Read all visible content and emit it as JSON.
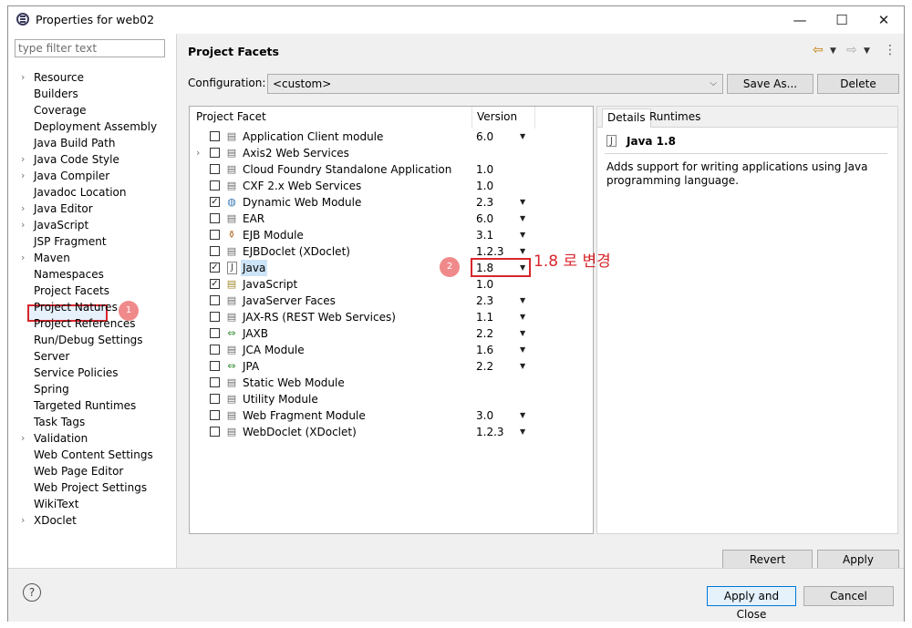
{
  "window": {
    "title": "Properties for web02",
    "minimize": "—",
    "maximize": "☐",
    "close": "✕"
  },
  "filter": {
    "placeholder": "type filter text"
  },
  "tree": {
    "items": [
      {
        "label": "Resource",
        "expandable": true
      },
      {
        "label": "Builders",
        "expandable": false
      },
      {
        "label": "Coverage",
        "expandable": false
      },
      {
        "label": "Deployment Assembly",
        "expandable": false
      },
      {
        "label": "Java Build Path",
        "expandable": false
      },
      {
        "label": "Java Code Style",
        "expandable": true
      },
      {
        "label": "Java Compiler",
        "expandable": true
      },
      {
        "label": "Javadoc Location",
        "expandable": false
      },
      {
        "label": "Java Editor",
        "expandable": true
      },
      {
        "label": "JavaScript",
        "expandable": true
      },
      {
        "label": "JSP Fragment",
        "expandable": false
      },
      {
        "label": "Maven",
        "expandable": true
      },
      {
        "label": "Namespaces",
        "expandable": false
      },
      {
        "label": "Project Facets",
        "expandable": false,
        "selected": true
      },
      {
        "label": "Project Natures",
        "expandable": false
      },
      {
        "label": "Project References",
        "expandable": false
      },
      {
        "label": "Run/Debug Settings",
        "expandable": false
      },
      {
        "label": "Server",
        "expandable": false
      },
      {
        "label": "Service Policies",
        "expandable": false
      },
      {
        "label": "Spring",
        "expandable": false
      },
      {
        "label": "Targeted Runtimes",
        "expandable": false
      },
      {
        "label": "Task Tags",
        "expandable": false
      },
      {
        "label": "Validation",
        "expandable": true
      },
      {
        "label": "Web Content Settings",
        "expandable": false
      },
      {
        "label": "Web Page Editor",
        "expandable": false
      },
      {
        "label": "Web Project Settings",
        "expandable": false
      },
      {
        "label": "WikiText",
        "expandable": false
      },
      {
        "label": "XDoclet",
        "expandable": true
      }
    ]
  },
  "annotations": {
    "badge1": "1",
    "badge2": "2",
    "note": "1.8 로 변경",
    "color": "#d8262c"
  },
  "page": {
    "title": "Project Facets"
  },
  "config": {
    "label": "Configuration:",
    "value": "<custom>",
    "save_as": "Save As...",
    "delete": "Delete"
  },
  "facets": {
    "header_facet": "Project Facet",
    "header_version": "Version",
    "rows": [
      {
        "name": "Application Client module",
        "version": "6.0",
        "checked": false,
        "dropdown": true,
        "icon": "page-icon"
      },
      {
        "name": "Axis2 Web Services",
        "version": "",
        "checked": false,
        "dropdown": false,
        "icon": "page-icon",
        "expandable": true
      },
      {
        "name": "Cloud Foundry Standalone Application",
        "version": "1.0",
        "checked": false,
        "dropdown": false,
        "icon": "page-icon"
      },
      {
        "name": "CXF 2.x Web Services",
        "version": "1.0",
        "checked": false,
        "dropdown": false,
        "icon": "page-icon"
      },
      {
        "name": "Dynamic Web Module",
        "version": "2.3",
        "checked": true,
        "dropdown": true,
        "icon": "globe-icon"
      },
      {
        "name": "EAR",
        "version": "6.0",
        "checked": false,
        "dropdown": true,
        "icon": "page-icon"
      },
      {
        "name": "EJB Module",
        "version": "3.1",
        "checked": false,
        "dropdown": true,
        "icon": "bean-icon"
      },
      {
        "name": "EJBDoclet (XDoclet)",
        "version": "1.2.3",
        "checked": false,
        "dropdown": true,
        "icon": "page-icon"
      },
      {
        "name": "Java",
        "version": "1.8",
        "checked": true,
        "dropdown": true,
        "icon": "java-icon",
        "highlight": true
      },
      {
        "name": "JavaScript",
        "version": "1.0",
        "checked": true,
        "dropdown": false,
        "icon": "js-icon"
      },
      {
        "name": "JavaServer Faces",
        "version": "2.3",
        "checked": false,
        "dropdown": true,
        "icon": "page-icon"
      },
      {
        "name": "JAX-RS (REST Web Services)",
        "version": "1.1",
        "checked": false,
        "dropdown": true,
        "icon": "page-icon"
      },
      {
        "name": "JAXB",
        "version": "2.2",
        "checked": false,
        "dropdown": true,
        "icon": "arrows-icon"
      },
      {
        "name": "JCA Module",
        "version": "1.6",
        "checked": false,
        "dropdown": true,
        "icon": "page-icon"
      },
      {
        "name": "JPA",
        "version": "2.2",
        "checked": false,
        "dropdown": true,
        "icon": "arrows-icon"
      },
      {
        "name": "Static Web Module",
        "version": "",
        "checked": false,
        "dropdown": false,
        "icon": "page-icon"
      },
      {
        "name": "Utility Module",
        "version": "",
        "checked": false,
        "dropdown": false,
        "icon": "page-icon"
      },
      {
        "name": "Web Fragment Module",
        "version": "3.0",
        "checked": false,
        "dropdown": true,
        "icon": "page-icon"
      },
      {
        "name": "WebDoclet (XDoclet)",
        "version": "1.2.3",
        "checked": false,
        "dropdown": true,
        "icon": "page-icon"
      }
    ]
  },
  "details": {
    "tab_details": "Details",
    "tab_runtimes": "Runtimes",
    "heading": "Java 1.8",
    "description": "Adds support for writing applications using Java programming language."
  },
  "buttons": {
    "revert": "Revert",
    "apply": "Apply",
    "apply_close": "Apply and Close",
    "cancel": "Cancel",
    "help": "?"
  }
}
